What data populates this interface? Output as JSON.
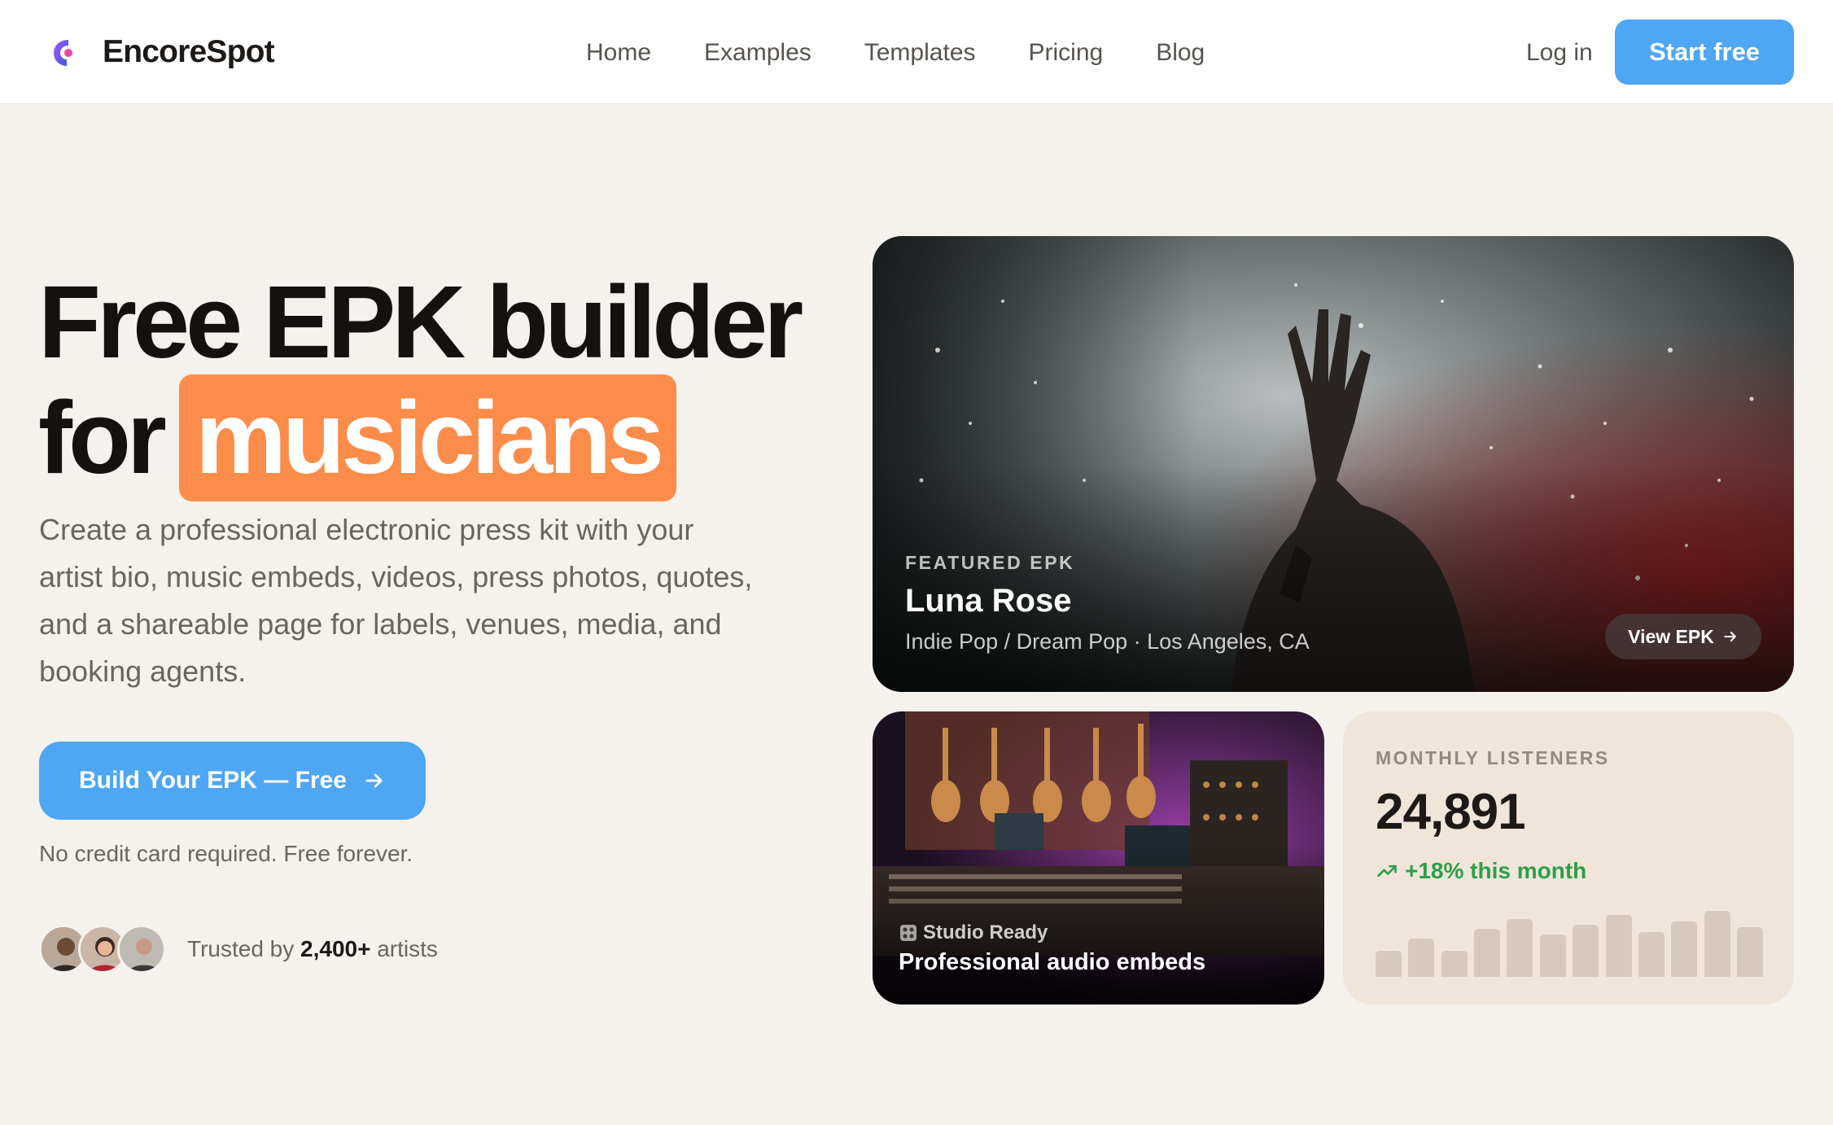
{
  "header": {
    "brand": "EncoreSpot",
    "nav": [
      "Home",
      "Examples",
      "Templates",
      "Pricing",
      "Blog"
    ],
    "login": "Log in",
    "start": "Start free"
  },
  "hero": {
    "headline_line1": "Free EPK builder",
    "headline_for": "for",
    "headline_highlight": "musicians",
    "subtitle": "Create a professional electronic press kit with your artist bio, music embeds, videos, press photos, quotes, and a shareable page for labels, venues, media, and booking agents.",
    "cta": "Build Your EPK — Free",
    "note": "No credit card required. Free forever.",
    "trust_prefix": "Trusted by",
    "trust_count": "2,400+",
    "trust_suffix": "artists"
  },
  "featured": {
    "eyebrow": "FEATURED EPK",
    "name": "Luna Rose",
    "genre": "Indie Pop / Dream Pop · Los Angeles, CA",
    "button": "View EPK"
  },
  "studio": {
    "label": "Studio Ready",
    "title": "Professional audio embeds"
  },
  "listeners": {
    "label": "MONTHLY LISTENERS",
    "value": "24,891",
    "growth": "+18% this month",
    "bars": [
      0.26,
      0.38,
      0.26,
      0.48,
      0.58,
      0.42,
      0.52,
      0.62,
      0.45,
      0.55,
      0.66,
      0.5
    ]
  },
  "colors": {
    "accent": "#4ea6f4",
    "highlight": "#fb8c4a",
    "growth": "#2e9e4a",
    "background": "#f5f1ec"
  }
}
